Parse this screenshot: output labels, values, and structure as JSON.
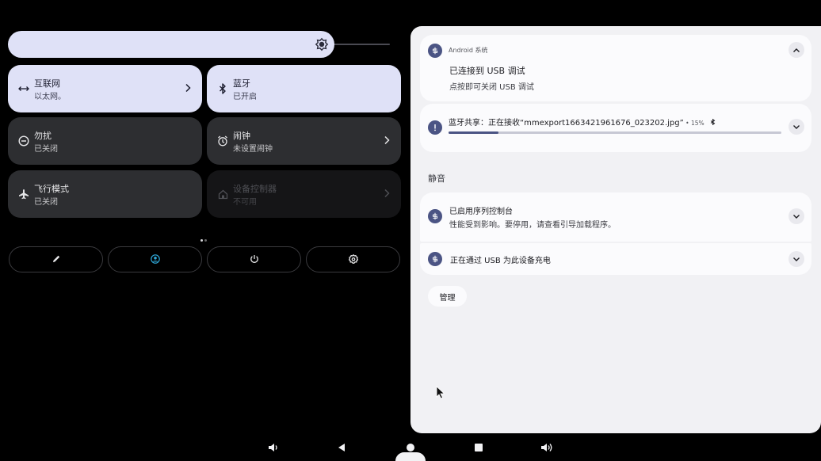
{
  "quick_settings": {
    "brightness": {
      "level": 0.85,
      "icon": "brightness-icon"
    },
    "tiles": [
      {
        "title": "互联网",
        "subtitle": "以太网。",
        "icon": "network-icon",
        "state": "on"
      },
      {
        "title": "蓝牙",
        "subtitle": "已开启",
        "icon": "bluetooth-icon",
        "state": "on"
      },
      {
        "title": "勿扰",
        "subtitle": "已关闭",
        "icon": "dnd-icon",
        "state": "off"
      },
      {
        "title": "闹钟",
        "subtitle": "未设置闹钟",
        "icon": "alarm-icon",
        "state": "off"
      },
      {
        "title": "飞行模式",
        "subtitle": "已关闭",
        "icon": "airplane-icon",
        "state": "off"
      },
      {
        "title": "设备控制器",
        "subtitle": "不可用",
        "icon": "home-icon",
        "state": "disabled"
      }
    ],
    "page_indicator": {
      "pages": 2,
      "current": 1
    },
    "footer_buttons": [
      "edit-icon",
      "user-icon",
      "power-icon",
      "settings-icon"
    ]
  },
  "notifications": {
    "usb_debug": {
      "app_name": "Android 系统",
      "title": "已连接到 USB 调试",
      "text": "点按即可关闭 USB 调试"
    },
    "bt_share": {
      "text": "蓝牙共享：正在接收“mmexport1663421961676_023202.jpg”",
      "percent_label": "15%",
      "progress": 0.15
    },
    "section_label": "静音",
    "serial_console": {
      "title": "已启用序列控制台",
      "text": "性能受到影响。要停用，请查看引导加载程序。"
    },
    "usb_charging": {
      "title": "正在通过 USB 为此设备充电"
    },
    "manage_label": "管理"
  },
  "colors": {
    "tile_on": "#dfe1f7",
    "tile_off": "#2d2e31",
    "accent": "#4b5484",
    "shade_bg": "#f1f1f4"
  },
  "nav_bar": [
    "volume-down-icon",
    "back-icon",
    "home-icon",
    "recents-icon",
    "volume-up-icon"
  ]
}
